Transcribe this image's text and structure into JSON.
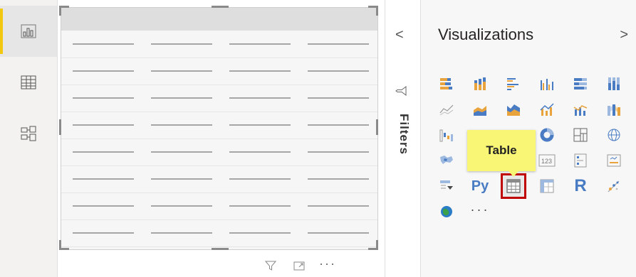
{
  "nav": {
    "items": [
      {
        "id": "report",
        "icon": "bar-chart-icon",
        "active": true
      },
      {
        "id": "data",
        "icon": "table-grid-icon",
        "active": false
      },
      {
        "id": "model",
        "icon": "model-relationship-icon",
        "active": false
      }
    ]
  },
  "canvas": {
    "visual_rows": 8,
    "visual_columns": 4,
    "footer_icons": [
      "filter-icon",
      "focus-mode-icon",
      "more-options-icon"
    ],
    "more_label": "···"
  },
  "filters": {
    "label": "Filters",
    "collapse_glyph": "<"
  },
  "visualizations": {
    "title": "Visualizations",
    "expand_glyph": ">",
    "tooltip": "Table",
    "selected": "table-visual-button",
    "rows": [
      [
        "stacked-bar-icon",
        "stacked-column-icon",
        "clustered-bar-icon",
        "clustered-column-icon",
        "100-stacked-bar-icon",
        "100-stacked-column-icon"
      ],
      [
        "line-chart-icon",
        "area-chart-icon",
        "stacked-area-icon",
        "line-column-icon",
        "line-clustered-column-icon",
        "ribbon-chart-icon"
      ],
      [
        "waterfall-icon",
        "",
        "",
        "donut-icon",
        "treemap-icon",
        "globe-map-icon"
      ],
      [
        "filled-map-icon",
        "",
        "",
        "card-icon",
        "multi-row-card-icon",
        "kpi-icon"
      ],
      [
        "slicer-icon",
        "python-visual-icon",
        "table-icon",
        "matrix-icon",
        "r-visual-icon",
        "key-influencers-icon"
      ],
      [
        "arcgis-icon",
        "more-visuals-icon"
      ]
    ],
    "python_label": "Py",
    "r_label": "R",
    "card_label": "123",
    "more_label": "···"
  },
  "colors": {
    "accent_yellow": "#f2c811",
    "selected_border": "#c00000",
    "tooltip_bg": "#f9f575",
    "chart_blue": "#4a7cc3",
    "chart_orange": "#e8a33d"
  }
}
